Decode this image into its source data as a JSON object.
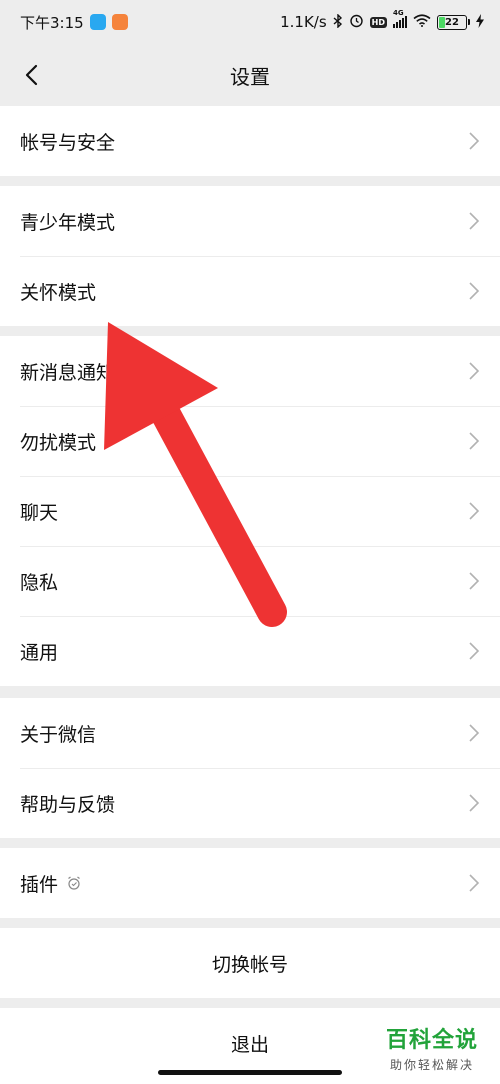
{
  "status_bar": {
    "time": "下午3:15",
    "net_speed": "1.1K/s",
    "network_type": "4G",
    "hd_label": "HD",
    "battery": "22",
    "battery_level_percent": 22,
    "icons": [
      "bluetooth-icon",
      "alarm-icon",
      "hd-icon",
      "signal-icon",
      "wifi-icon",
      "battery-icon",
      "charging-icon"
    ]
  },
  "nav": {
    "title": "设置",
    "back_icon": "chevron-left-icon"
  },
  "groups": [
    {
      "items": [
        {
          "label": "帐号与安全"
        }
      ]
    },
    {
      "items": [
        {
          "label": "青少年模式"
        },
        {
          "label": "关怀模式"
        }
      ]
    },
    {
      "items": [
        {
          "label": "新消息通知"
        },
        {
          "label": "勿扰模式"
        },
        {
          "label": "聊天"
        },
        {
          "label": "隐私"
        },
        {
          "label": "通用"
        }
      ]
    },
    {
      "items": [
        {
          "label": "关于微信"
        },
        {
          "label": "帮助与反馈"
        }
      ]
    },
    {
      "items": [
        {
          "label": "插件"
        }
      ]
    }
  ],
  "actions": {
    "switch_account": "切换帐号",
    "logout": "退出"
  },
  "watermark": {
    "title": "百科全说",
    "subtitle": "助你轻松解决"
  },
  "colors": {
    "background": "#ededed",
    "card": "#ffffff",
    "annotation_arrow": "#ee3333",
    "watermark_green": "#22a33a"
  }
}
